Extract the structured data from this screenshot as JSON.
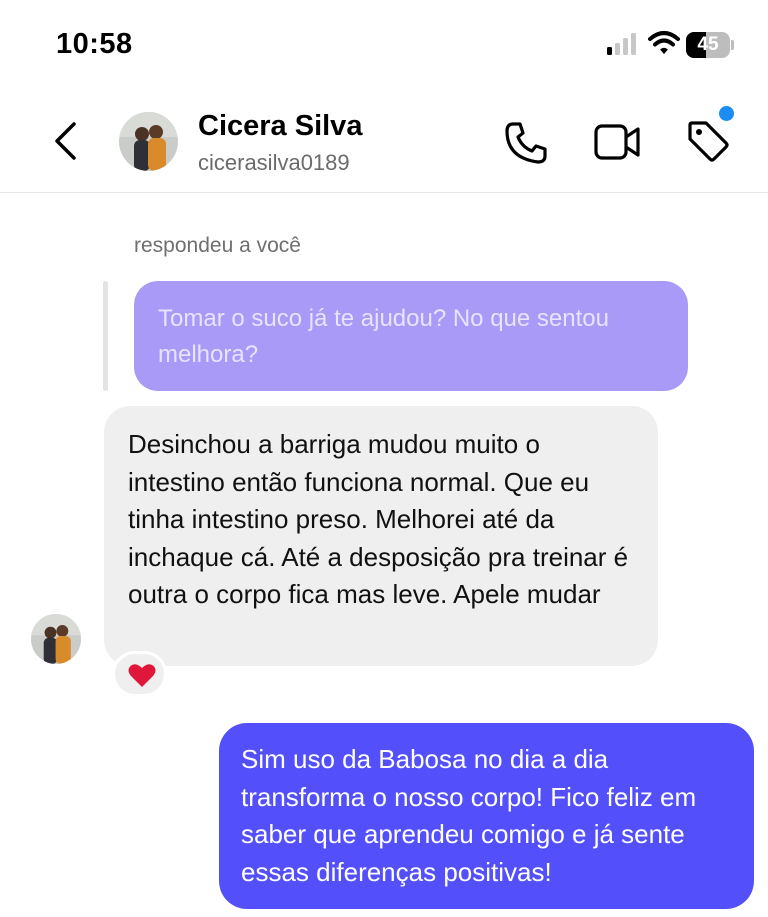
{
  "status_bar": {
    "time": "10:58",
    "battery": "45",
    "battery_level_percent": 45
  },
  "header": {
    "contact_name": "Cicera Silva",
    "username": "cicerasilva0189",
    "icons": [
      "back-chevron-icon",
      "phone-icon",
      "video-camera-icon",
      "tag-icon"
    ],
    "notification_dot_color": "#1c8cf5"
  },
  "conversation": {
    "reply_label": "respondeu a você",
    "quoted_message": "Tomar o suco já te ajudou? No que sentou melhora?",
    "received_message": "Desinchou a barriga mudou muito o intestino então funciona normal. Que eu tinha intestino preso. Melhorei até da inchaque cá. Até a desposição pra treinar é outra o corpo fica mas leve. Apele mudar",
    "reaction": "❤️",
    "sent_message": "Sim uso da Babosa no dia a dia transforma o nosso corpo! Fico feliz em saber que aprendeu comigo e já sente essas diferenças positivas!"
  },
  "colors": {
    "sent_bubble": "#5350fb",
    "quoted_bubble": "#a99af8",
    "received_bubble": "#efefef",
    "heart": "#e0173a"
  }
}
